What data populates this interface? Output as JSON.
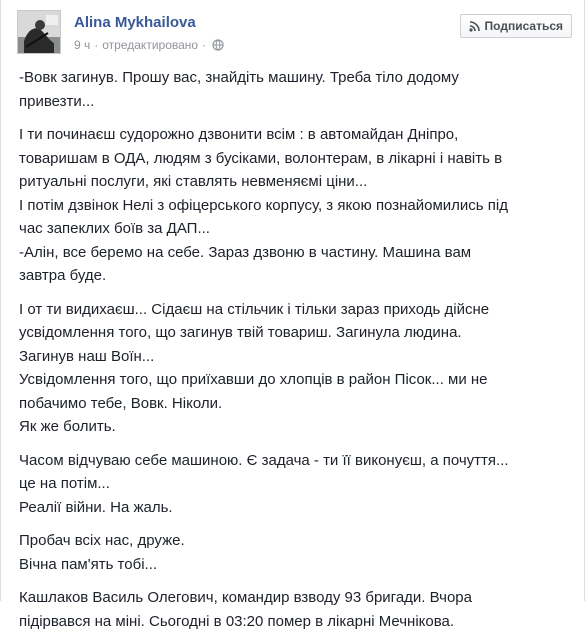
{
  "author": {
    "name": "Alina Mykhailova"
  },
  "meta": {
    "time": "9 ч",
    "edited": "отредактировано",
    "separator": "·"
  },
  "follow_button": {
    "label": "Подписаться",
    "icon": "rss-icon"
  },
  "post": {
    "paragraphs": [
      {
        "lines": [
          "-Вовк загинув. Прошу вас, знайдіть машину. Треба тіло додому",
          "привезти..."
        ]
      },
      {
        "lines": [
          "І ти починаєш судорожно дзвонити всім : в автомайдан Дніпро,",
          "товаришам в ОДА, людям з бусіками, волонтерам, в лікарні і навіть в",
          "ритуальні послуги, які ставлять невменяємі ціни...",
          "І потім дзвінок Нелі з офіцерського корпусу, з якою познайомились під",
          "час запеклих боїв за ДАП...",
          "-Алін, все беремо на себе. Зараз дзвоню в частину. Машина вам",
          "завтра буде."
        ]
      },
      {
        "lines": [
          "І от ти видихаєш... Сідаєш на стільчик і тільки зараз приходь дійсне",
          "усвідомлення того, що загинув твій товариш. Загинула людина.",
          "Загинув наш Воїн...",
          "Усвідомлення того, що приїхавши до хлопців в район Пісок... ми не",
          "побачимо тебе, Вовк. Ніколи.",
          "Як же болить."
        ]
      },
      {
        "lines": [
          "Часом відчуваю себе машиною. Є задача - ти її виконуєш, а почуття...",
          "це на потім...",
          "Реалії війни. На жаль."
        ]
      },
      {
        "lines": [
          "Пробач всіх нас, друже.",
          "Вічна пам'ять тобі..."
        ]
      },
      {
        "lines": [
          "Кашлаков Василь Олегович, командир взводу 93 бригади. Вчора",
          "підірвався на міні. Сьогодні в 03:20 помер в лікарні Мечнікова."
        ]
      }
    ]
  },
  "colors": {
    "author_link": "#3b5998",
    "meta_text": "#90949c",
    "body_text": "#1d2129",
    "button_border": "#ced0d4"
  }
}
